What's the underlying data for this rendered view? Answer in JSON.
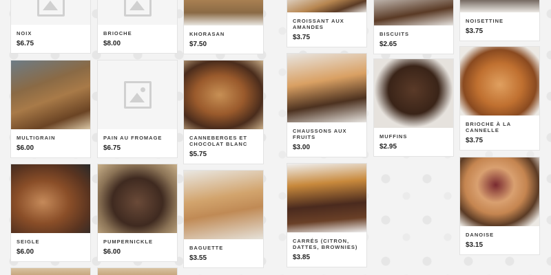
{
  "products": [
    {
      "name": "NOIX",
      "price": "$6.75",
      "image": "placeholder"
    },
    {
      "name": "BRIOCHE",
      "price": "$8.00",
      "image": "placeholder"
    },
    {
      "name": "KHORASAN",
      "price": "$7.50",
      "image": "photo"
    },
    {
      "name": "CROISSANT AUX AMANDES",
      "price": "$3.75",
      "image": "photo"
    },
    {
      "name": "BISCUITS",
      "price": "$2.65",
      "image": "photo"
    },
    {
      "name": "NOISETTINE",
      "price": "$3.75",
      "image": "photo"
    },
    {
      "name": "MULTIGRAIN",
      "price": "$6.00",
      "image": "photo"
    },
    {
      "name": "PAIN AU FROMAGE",
      "price": "$6.75",
      "image": "placeholder"
    },
    {
      "name": "CANNEBERGES ET CHOCOLAT BLANC",
      "price": "$5.75",
      "image": "photo"
    },
    {
      "name": "CHAUSSONS AUX FRUITS",
      "price": "$3.00",
      "image": "photo"
    },
    {
      "name": "MUFFINS",
      "price": "$2.95",
      "image": "photo"
    },
    {
      "name": "BRIOCHE À LA CANNELLE",
      "price": "$3.75",
      "image": "photo"
    },
    {
      "name": "SEIGLE",
      "price": "$6.00",
      "image": "photo"
    },
    {
      "name": "PUMPERNICKLE",
      "price": "$6.00",
      "image": "photo"
    },
    {
      "name": "BAGUETTE",
      "price": "$3.55",
      "image": "photo"
    },
    {
      "name": "CARRÉS (CITRON, DATTES, BROWNIES)",
      "price": "$3.85",
      "image": "photo"
    },
    {
      "name": "DANOISE",
      "price": "$3.15",
      "image": "photo"
    }
  ],
  "colors": {
    "card_background": "#ffffff",
    "name_text": "#3b3b3b",
    "price_text": "#222222",
    "page_pattern": "#f3f3f3"
  }
}
